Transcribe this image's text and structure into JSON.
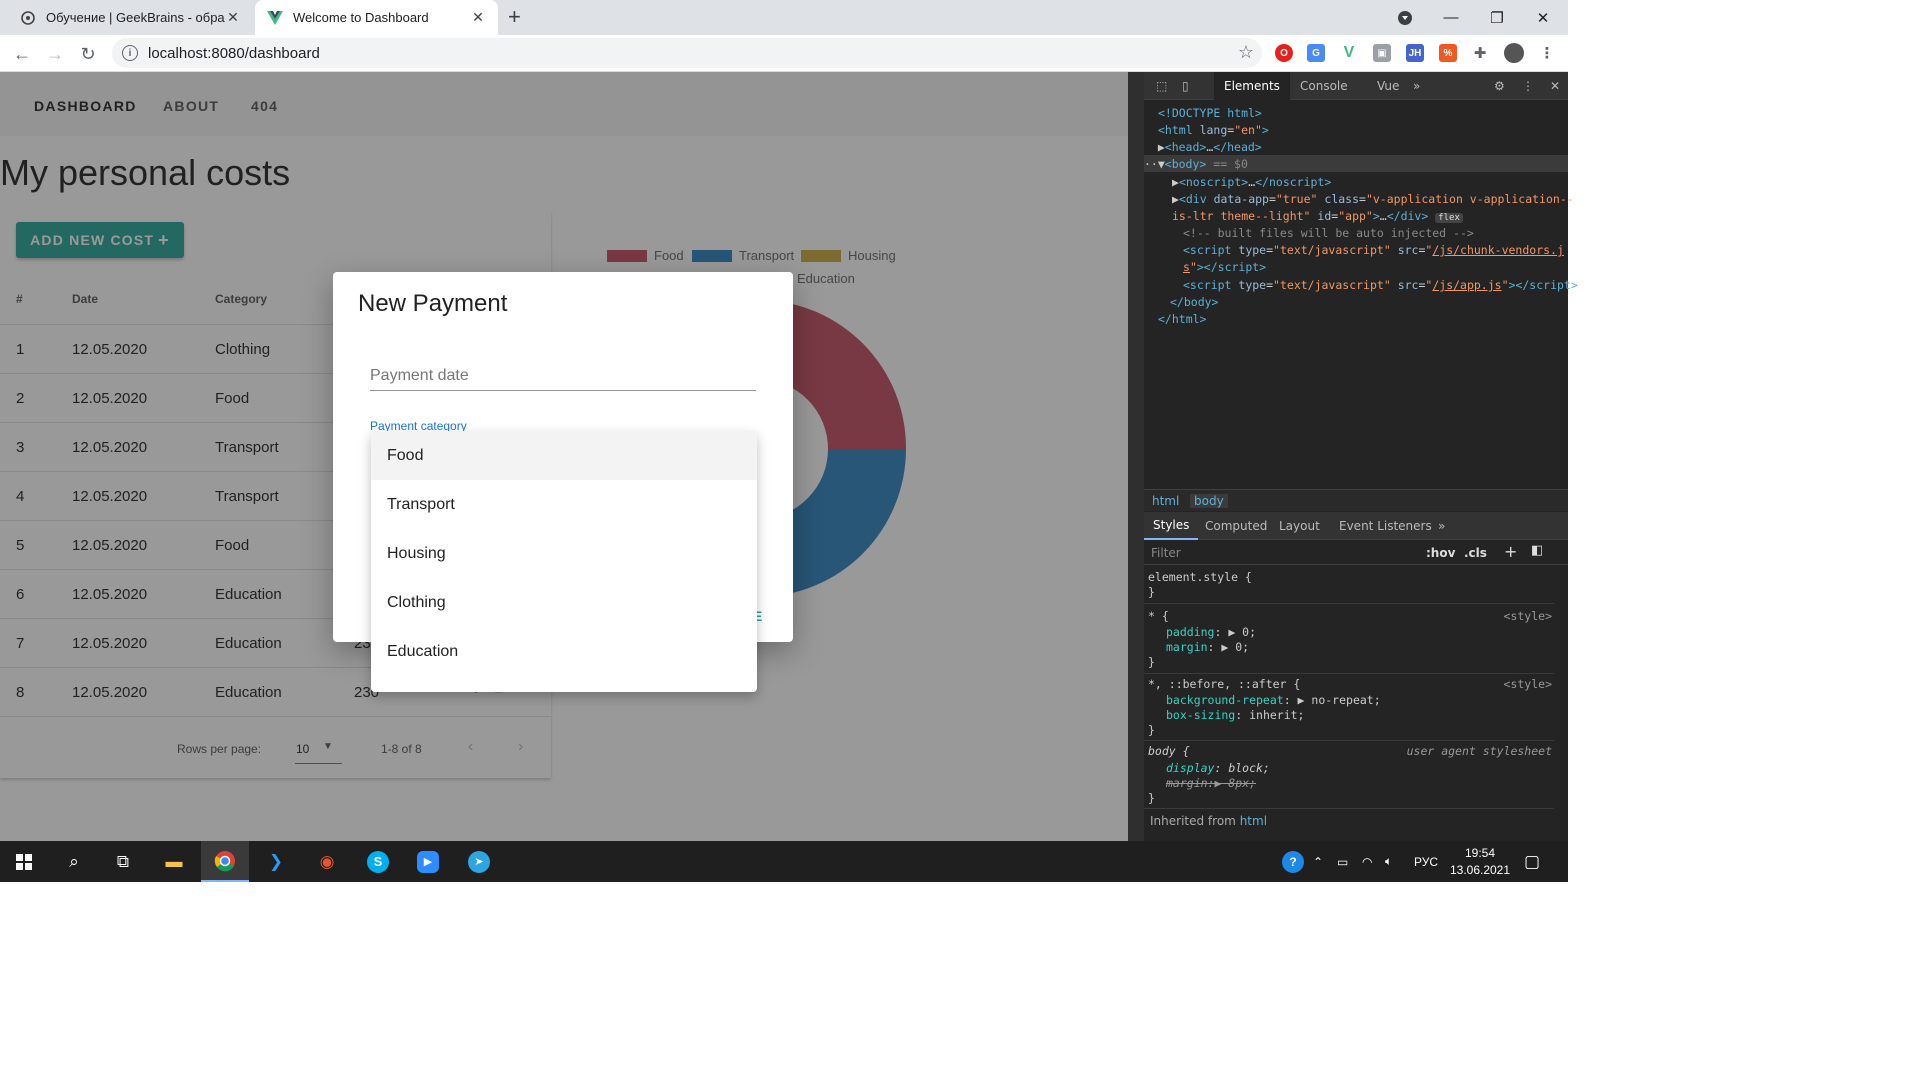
{
  "browser": {
    "tabs": [
      {
        "title": "Обучение | GeekBrains - образо",
        "active": false
      },
      {
        "title": "Welcome to Dashboard",
        "active": true
      }
    ],
    "url": "localhost:8080/dashboard"
  },
  "app": {
    "nav": [
      "DASHBOARD",
      "ABOUT",
      "404"
    ],
    "page_title": "My personal costs",
    "add_button": "ADD NEW COST",
    "table": {
      "headers": [
        "#",
        "Date",
        "Category"
      ],
      "rows": [
        {
          "n": "1",
          "date": "12.05.2020",
          "category": "Clothing",
          "value": ""
        },
        {
          "n": "2",
          "date": "12.05.2020",
          "category": "Food",
          "value": ""
        },
        {
          "n": "3",
          "date": "12.05.2020",
          "category": "Transport",
          "value": ""
        },
        {
          "n": "4",
          "date": "12.05.2020",
          "category": "Transport",
          "value": ""
        },
        {
          "n": "5",
          "date": "12.05.2020",
          "category": "Food",
          "value": ""
        },
        {
          "n": "6",
          "date": "12.05.2020",
          "category": "Education",
          "value": ""
        },
        {
          "n": "7",
          "date": "12.05.2020",
          "category": "Education",
          "value": "23"
        },
        {
          "n": "8",
          "date": "12.05.2020",
          "category": "Education",
          "value": "230"
        }
      ],
      "rows_per_page_label": "Rows per page:",
      "rows_per_page": "10",
      "range": "1-8 of 8"
    },
    "chart": {
      "legend": [
        {
          "label": "Food",
          "color": "#c44e62"
        },
        {
          "label": "Transport",
          "color": "#2e84bf"
        },
        {
          "label": "Housing",
          "color": "#cda843"
        },
        {
          "label": "Education",
          "color": ""
        }
      ]
    },
    "dialog": {
      "title": "New Payment",
      "date_placeholder": "Payment date",
      "category_label": "Payment category",
      "save_hint": "E"
    },
    "dropdown": {
      "options": [
        "Food",
        "Transport",
        "Housing",
        "Clothing",
        "Education"
      ],
      "highlighted": "Food"
    }
  },
  "devtools": {
    "tabs": [
      "Elements",
      "Console",
      "Vue"
    ],
    "breadcrumbs": [
      "html",
      "body"
    ],
    "style_tabs": [
      "Styles",
      "Computed",
      "Layout",
      "Event Listeners"
    ],
    "filter_placeholder": "Filter",
    "hov": ":hov",
    "cls": ".cls",
    "inherited_label": "Inherited from",
    "inherited_tag": "html"
  },
  "taskbar": {
    "language": "РУС",
    "time": "19:54",
    "date": "13.06.2021"
  }
}
